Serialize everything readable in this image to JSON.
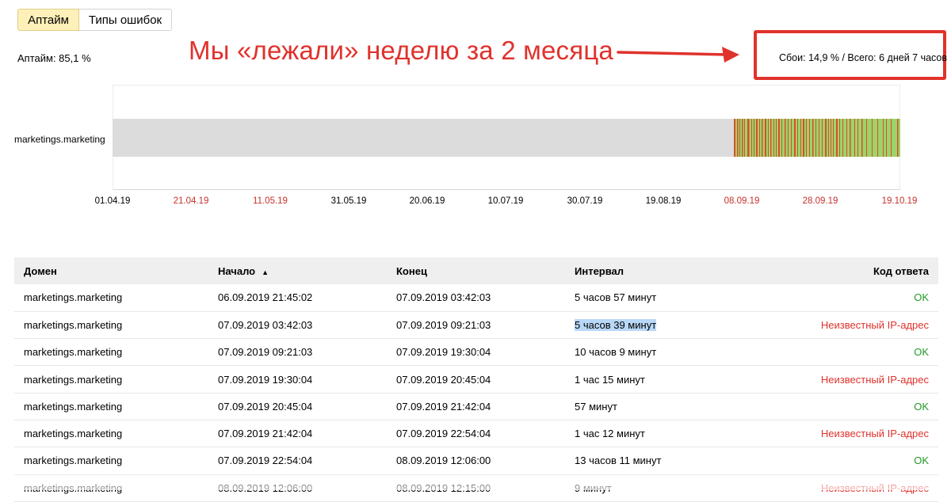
{
  "tabs": [
    {
      "label": "Аптайм",
      "active": true
    },
    {
      "label": "Типы ошибок",
      "active": false
    }
  ],
  "uptime_text": "Аптайм: 85,1 %",
  "annotation": "Мы «лежали» неделю за 2 месяца",
  "summary": "Сбои: 14,9 % / Всего: 6 дней 7 часов",
  "timeline": {
    "row_label": "marketings.marketing",
    "ticks": [
      {
        "label": "01.04.19",
        "weekend": false
      },
      {
        "label": "21.04.19",
        "weekend": true
      },
      {
        "label": "11.05.19",
        "weekend": true
      },
      {
        "label": "31.05.19",
        "weekend": false
      },
      {
        "label": "20.06.19",
        "weekend": false
      },
      {
        "label": "10.07.19",
        "weekend": false
      },
      {
        "label": "30.07.19",
        "weekend": false
      },
      {
        "label": "19.08.19",
        "weekend": false
      },
      {
        "label": "08.09.19",
        "weekend": true
      },
      {
        "label": "28.09.19",
        "weekend": true
      },
      {
        "label": "19.10.19",
        "weekend": true
      }
    ],
    "colors": {
      "no_data": "#dcdcdc",
      "ok": "#9ed36a",
      "fail": "#d8502a"
    }
  },
  "table": {
    "headers": {
      "domain": "Домен",
      "start": "Начало",
      "start_sort": "▲",
      "end": "Конец",
      "interval": "Интервал",
      "code": "Код ответа"
    },
    "rows": [
      {
        "domain": "marketings.marketing",
        "start": "06.09.2019 21:45:02",
        "end": "07.09.2019 03:42:03",
        "interval": "5 часов 57 минут",
        "code": "OK",
        "ok": true
      },
      {
        "domain": "marketings.marketing",
        "start": "07.09.2019 03:42:03",
        "end": "07.09.2019 09:21:03",
        "interval": "5 часов 39 минут",
        "code": "Неизвестный IP-адрес",
        "ok": false
      },
      {
        "domain": "marketings.marketing",
        "start": "07.09.2019 09:21:03",
        "end": "07.09.2019 19:30:04",
        "interval": "10 часов 9 минут",
        "code": "OK",
        "ok": true
      },
      {
        "domain": "marketings.marketing",
        "start": "07.09.2019 19:30:04",
        "end": "07.09.2019 20:45:04",
        "interval": "1 час 15 минут",
        "code": "Неизвестный IP-адрес",
        "ok": false
      },
      {
        "domain": "marketings.marketing",
        "start": "07.09.2019 20:45:04",
        "end": "07.09.2019 21:42:04",
        "interval": "57 минут",
        "code": "OK",
        "ok": true
      },
      {
        "domain": "marketings.marketing",
        "start": "07.09.2019 21:42:04",
        "end": "07.09.2019 22:54:04",
        "interval": "1 час 12 минут",
        "code": "Неизвестный IP-адрес",
        "ok": false
      },
      {
        "domain": "marketings.marketing",
        "start": "07.09.2019 22:54:04",
        "end": "08.09.2019 12:06:00",
        "interval": "13 часов 11 минут",
        "code": "OK",
        "ok": true
      },
      {
        "domain": "marketings.marketing",
        "start": "08.09.2019 12:06:00",
        "end": "08.09.2019 12:15:00",
        "interval": "9 минут",
        "code": "Неизвестный IP-адрес",
        "ok": false
      }
    ]
  }
}
